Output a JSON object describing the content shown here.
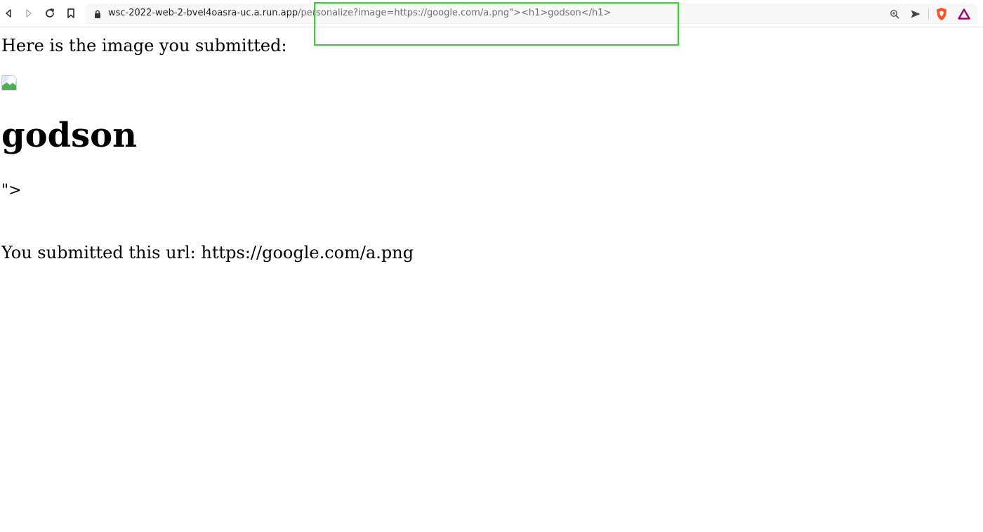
{
  "browser": {
    "url_host": "wsc-2022-web-2-bvel4oasra-uc.a.run.app",
    "url_path": "/personalize?image=https://google.com/a.png\"><h1>godson</h1>",
    "icons": {
      "back": "back-arrow-icon",
      "forward": "forward-arrow-icon",
      "reload": "reload-icon",
      "bookmark": "bookmark-icon",
      "lock": "lock-icon",
      "zoom": "zoom-icon",
      "share": "share-icon",
      "brave_shields": "brave-shields-icon",
      "brave_rewards": "brave-rewards-icon"
    },
    "colors": {
      "highlight_box": "#22e01e",
      "brave_orange": "#fb542b",
      "rewards_purple": "#a0006e"
    }
  },
  "page": {
    "intro": "Here is the image you submitted:",
    "injected_heading": "godson",
    "leftover_text": "\">",
    "submitted_url_line": "You submitted this url: https://google.com/a.png"
  }
}
